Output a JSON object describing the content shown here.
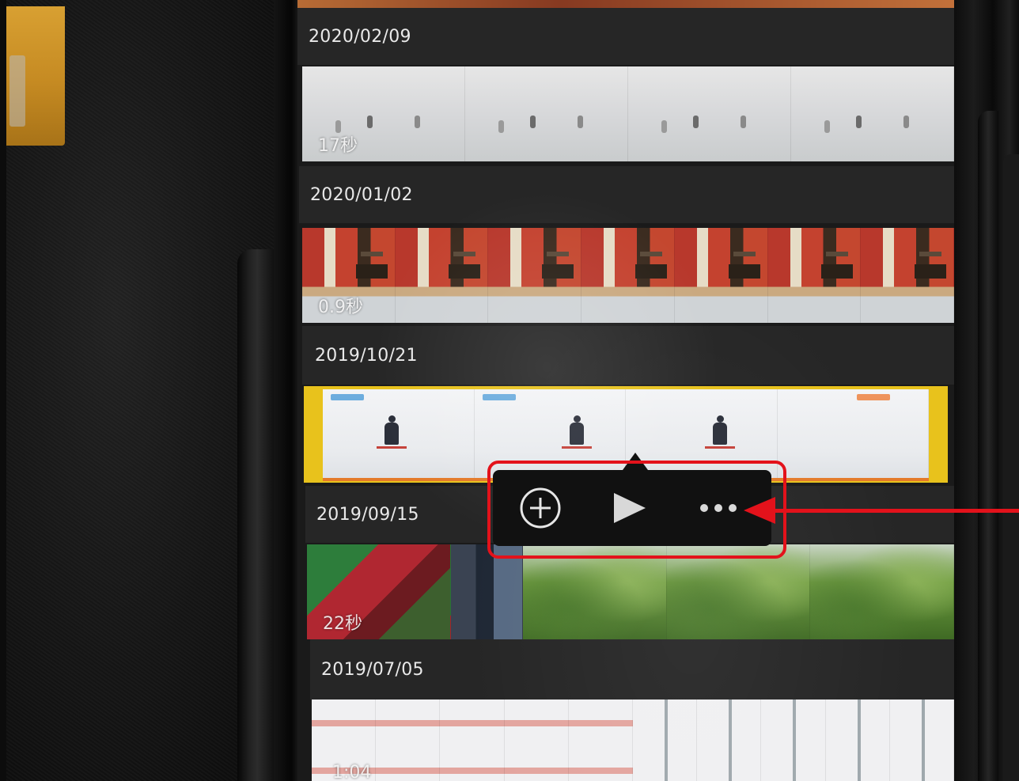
{
  "rows": [
    {
      "date": "2020/02/09",
      "duration": "17秒"
    },
    {
      "date": "2020/01/02",
      "duration": "0.9秒"
    },
    {
      "date": "2019/10/21",
      "duration": ""
    },
    {
      "date": "2019/09/15",
      "duration": "22秒"
    },
    {
      "date": "2019/07/05",
      "duration": "1:04"
    }
  ],
  "popover": {
    "add_icon": "plus-circle-icon",
    "play_icon": "play-icon",
    "more_icon": "ellipsis-icon"
  },
  "annotation": {
    "color": "#e3121b"
  },
  "colors": {
    "selection": "#e8c21c",
    "header_bg": "#262626",
    "popover_bg": "#111111"
  }
}
